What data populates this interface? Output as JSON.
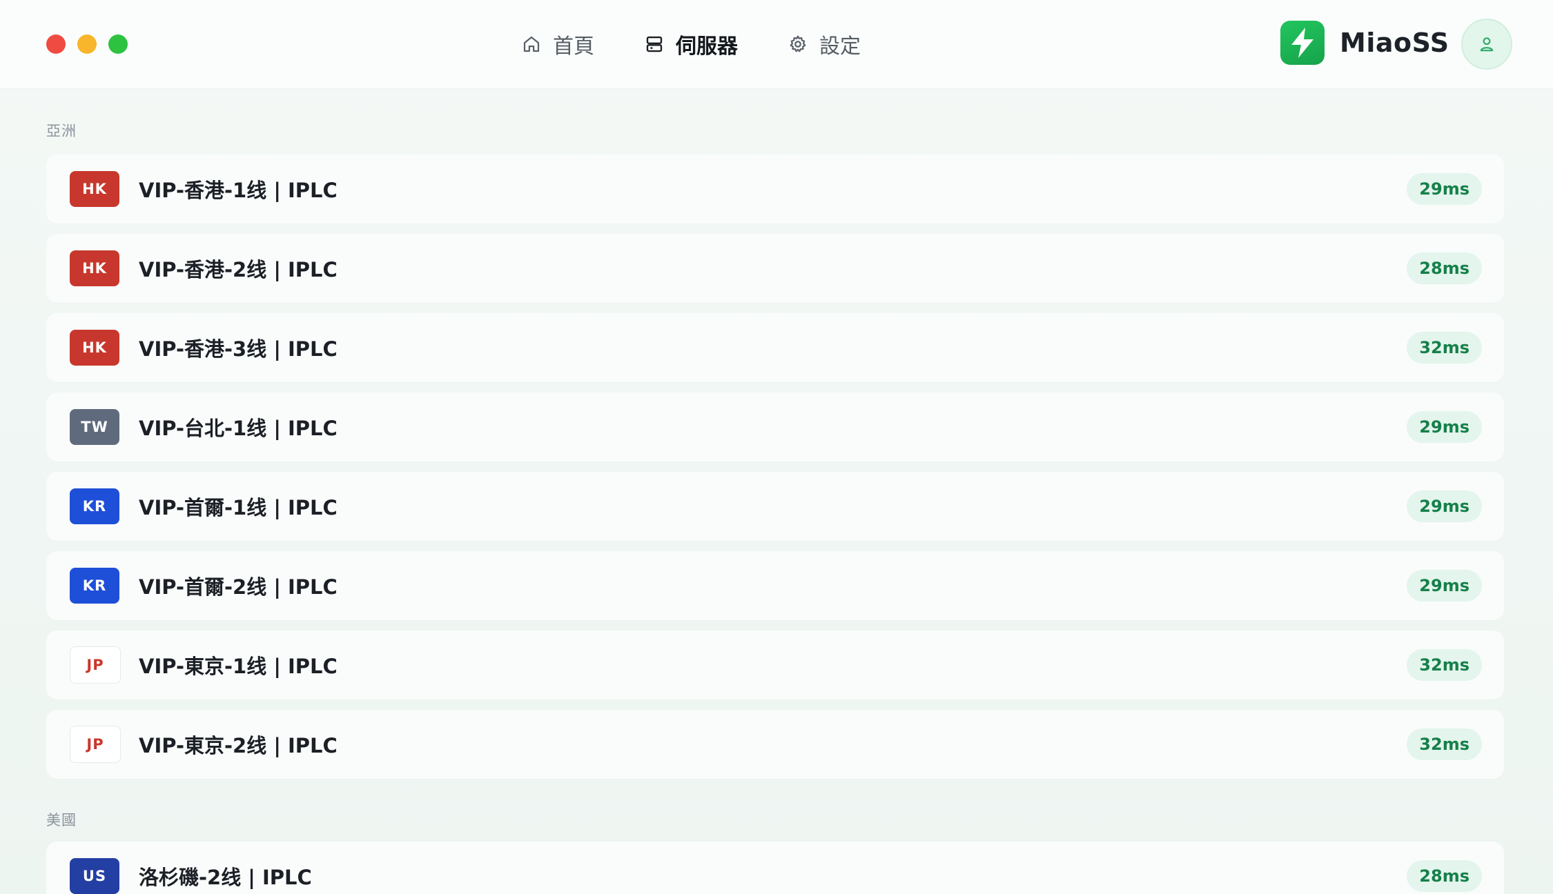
{
  "nav": {
    "items": [
      {
        "label": "首頁",
        "icon": "home-icon",
        "active": false
      },
      {
        "label": "伺服器",
        "icon": "server-icon",
        "active": true
      },
      {
        "label": "設定",
        "icon": "gear-icon",
        "active": false
      }
    ]
  },
  "brand": {
    "name": "MiaoSS",
    "logo_icon": "lightning-bolt-icon",
    "accent": "#22c55e"
  },
  "user": {
    "avatar_icon": "user-icon"
  },
  "groups": [
    {
      "label": "亞洲",
      "servers": [
        {
          "code": "HK",
          "name": "VIP-香港-1线 | IPLC",
          "latency": "29ms"
        },
        {
          "code": "HK",
          "name": "VIP-香港-2线 | IPLC",
          "latency": "28ms"
        },
        {
          "code": "HK",
          "name": "VIP-香港-3线 | IPLC",
          "latency": "32ms"
        },
        {
          "code": "TW",
          "name": "VIP-台北-1线 | IPLC",
          "latency": "29ms"
        },
        {
          "code": "KR",
          "name": "VIP-首爾-1线 | IPLC",
          "latency": "29ms"
        },
        {
          "code": "KR",
          "name": "VIP-首爾-2线 | IPLC",
          "latency": "29ms"
        },
        {
          "code": "JP",
          "name": "VIP-東京-1线 | IPLC",
          "latency": "32ms"
        },
        {
          "code": "JP",
          "name": "VIP-東京-2线 | IPLC",
          "latency": "32ms"
        }
      ]
    },
    {
      "label": "美國",
      "servers": [
        {
          "code": "US",
          "name": "洛杉磯-2线 | IPLC",
          "latency": "28ms"
        }
      ]
    }
  ],
  "colors": {
    "hk": "#c8372d",
    "tw": "#5f6b7d",
    "kr": "#1e4fd8",
    "us": "#243fa3",
    "jp": "#ffffff",
    "latency_text": "#16804a",
    "latency_bg": "#e3f5ec"
  }
}
